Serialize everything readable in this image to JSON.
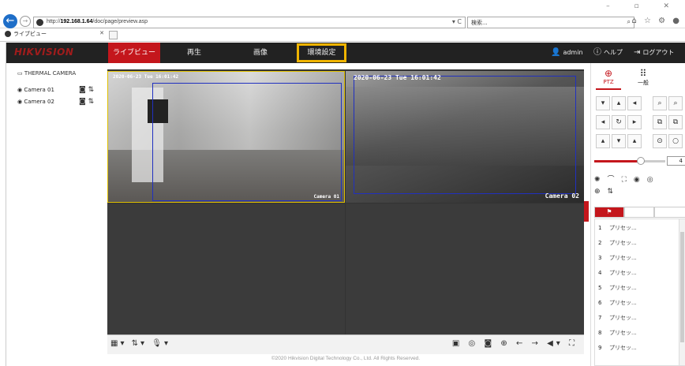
{
  "browser": {
    "url_prefix": "http://",
    "url_host": "192.168.1.64",
    "url_path": "/doc/page/preview.asp",
    "url_controls": "▾ C",
    "search_placeholder": "検索...",
    "search_icon": "⌕",
    "window_controls": "– ▫ ✕",
    "toolbar_icons": "⌂ ☆ ⚙ ●",
    "tab_title": "ライブビュー",
    "tab_close": "✕"
  },
  "app": {
    "logo": "HIKVISION",
    "nav": [
      {
        "label": "ライブビュー"
      },
      {
        "label": "再生"
      },
      {
        "label": "画像"
      },
      {
        "label": "環境設定"
      }
    ],
    "user": "admin",
    "help": "ヘルプ",
    "logout": "ログアウト"
  },
  "tree": {
    "root": "THERMAL CAMERA",
    "cameras": [
      {
        "label": "Camera 01"
      },
      {
        "label": "Camera 02"
      }
    ]
  },
  "video": {
    "cam1_timestamp": "2020-06-23 Tue 16:01:42",
    "cam1_name": "Camera 01",
    "cam2_timestamp": "2020-06-23 Tue 16:01:42",
    "cam2_name": "Camera 02"
  },
  "ptz": {
    "tab_ptz": "PTZ",
    "tab_general": "一般",
    "speed_value": "4",
    "speed_fraction": 0.66
  },
  "presets": [
    {
      "num": "1",
      "label": "プリセッ..."
    },
    {
      "num": "2",
      "label": "プリセッ..."
    },
    {
      "num": "3",
      "label": "プリセッ..."
    },
    {
      "num": "4",
      "label": "プリセッ..."
    },
    {
      "num": "5",
      "label": "プリセッ..."
    },
    {
      "num": "6",
      "label": "プリセッ..."
    },
    {
      "num": "7",
      "label": "プリセッ..."
    },
    {
      "num": "8",
      "label": "プリセッ..."
    },
    {
      "num": "9",
      "label": "プリセッ..."
    }
  ],
  "footer": "©2020 Hikvision Digital Technology Co., Ltd. All Rights Reserved."
}
